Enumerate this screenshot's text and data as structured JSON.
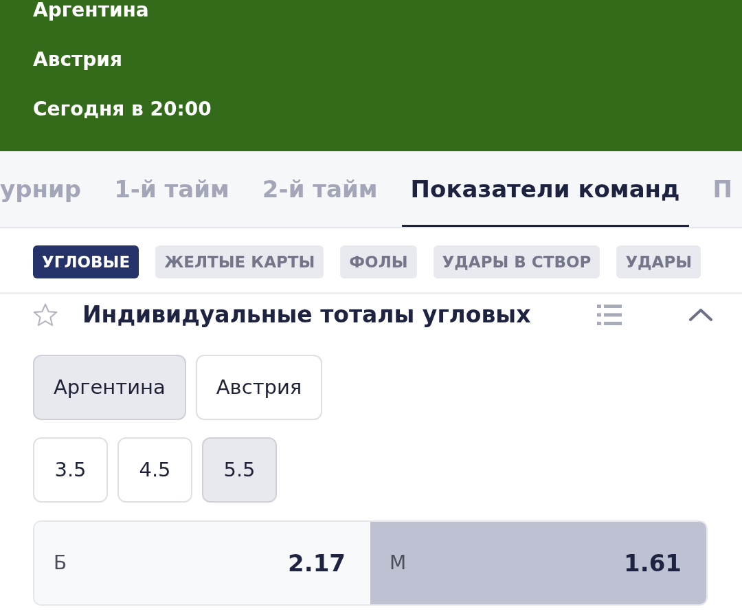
{
  "match": {
    "home": "Аргентина",
    "away": "Австрия",
    "start_time": "Сегодня в 20:00"
  },
  "tabs": [
    {
      "label": "урнир",
      "selected": false
    },
    {
      "label": "1-й тайм",
      "selected": false
    },
    {
      "label": "2-й тайм",
      "selected": false
    },
    {
      "label": "Показатели команд",
      "selected": true
    },
    {
      "label": "П",
      "selected": false
    }
  ],
  "categories": [
    {
      "label": "УГЛОВЫЕ",
      "selected": true
    },
    {
      "label": "ЖЕЛТЫЕ КАРТЫ",
      "selected": false
    },
    {
      "label": "ФОЛЫ",
      "selected": false
    },
    {
      "label": "УДАРЫ В СТВОР",
      "selected": false
    },
    {
      "label": "УДАРЫ",
      "selected": false
    }
  ],
  "market": {
    "title": "Индивидуальные тоталы угловых",
    "favorite": false,
    "expanded": true,
    "teams": [
      {
        "label": "Аргентина",
        "selected": true
      },
      {
        "label": "Австрия",
        "selected": false
      }
    ],
    "lines": [
      {
        "label": "3.5",
        "selected": false
      },
      {
        "label": "4.5",
        "selected": false
      },
      {
        "label": "5.5",
        "selected": true
      }
    ],
    "outcomes": [
      {
        "label": "Б",
        "odds": "2.17",
        "selected": false
      },
      {
        "label": "М",
        "odds": "1.61",
        "selected": true
      }
    ]
  }
}
